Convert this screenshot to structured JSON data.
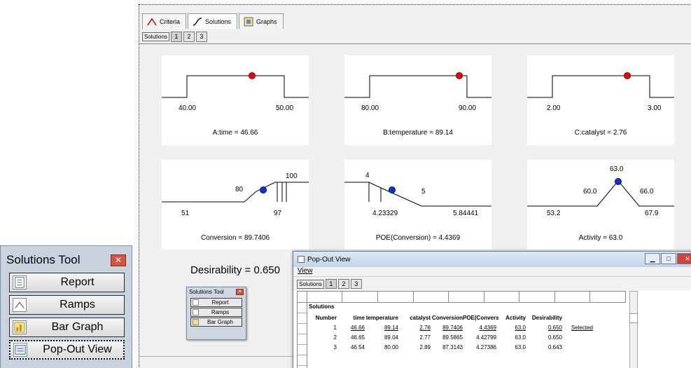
{
  "main": {
    "tabs": [
      {
        "label": "Criteria",
        "icon": "criteria-icon"
      },
      {
        "label": "Solutions",
        "icon": "solutions-icon"
      },
      {
        "label": "Graphs",
        "icon": "graphs-icon"
      }
    ],
    "subtabs": {
      "label": "Solutions",
      "items": [
        "1",
        "2",
        "3"
      ],
      "selected": "1"
    },
    "ramps": [
      {
        "low": "40.00",
        "high": "50.00",
        "caption": "A:time = 46.66"
      },
      {
        "low": "80.00",
        "high": "90.00",
        "caption": "B:temperature = 89.14"
      },
      {
        "low": "2.00",
        "high": "3.00",
        "caption": "C:catalyst = 2.76"
      },
      {
        "low": "51",
        "high": "97",
        "target": "80",
        "upper": "100",
        "caption": "Conversion = 89.7406"
      },
      {
        "top": "4",
        "low": "4.23329",
        "mid": "5",
        "high": "5.84441",
        "caption": "POE(Conversion) = 4.4369"
      },
      {
        "peak": "63.0",
        "left": "60.0",
        "right": "66.0",
        "low": "53.2",
        "high": "67.9",
        "caption": "Activity = 63.0"
      }
    ],
    "desirability": "Desirability = 0.650"
  },
  "mini_tool": {
    "title": "Solutions Tool",
    "buttons": [
      "Report",
      "Ramps",
      "Bar Graph"
    ]
  },
  "big_tool": {
    "title": "Solutions Tool",
    "buttons": [
      "Report",
      "Ramps",
      "Bar Graph",
      "Pop-Out View"
    ]
  },
  "popout": {
    "title": "Pop-Out View",
    "menu": "View",
    "subtabs": {
      "label": "Solutions",
      "items": [
        "1",
        "2",
        "3"
      ]
    },
    "section": "Solutions",
    "columns": [
      "Number",
      "time",
      "temperature",
      "catalyst",
      "Conversion",
      "POE(Convers",
      "Activity",
      "Desirability",
      ""
    ],
    "rows": [
      [
        "1",
        "46.66",
        "89.14",
        "2.76",
        "89.7406",
        "4.4369",
        "63.0",
        "0.650",
        "Selected"
      ],
      [
        "2",
        "46.65",
        "89.04",
        "2.77",
        "89.5865",
        "4.42799",
        "63.0",
        "0.650",
        ""
      ],
      [
        "3",
        "46.54",
        "80.00",
        "2.89",
        "87.3143",
        "4.27386",
        "63.0",
        "0.643",
        ""
      ]
    ]
  }
}
